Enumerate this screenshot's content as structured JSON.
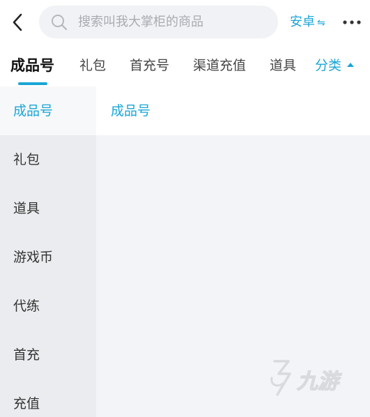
{
  "header": {
    "back_icon": "chevron-left-icon",
    "search": {
      "icon": "search-icon",
      "placeholder": "搜索叫我大掌柜的商品"
    },
    "platform": {
      "label": "安卓",
      "icon": "swap-arrows-icon"
    },
    "more_icon": "more-dots-icon"
  },
  "tabs": {
    "items": [
      {
        "label": "成品号",
        "active": true
      },
      {
        "label": "礼包"
      },
      {
        "label": "首充号"
      },
      {
        "label": "渠道充值"
      },
      {
        "label": "道具"
      }
    ],
    "category_button": {
      "label": "分类",
      "icon": "triangle-up-icon"
    }
  },
  "sidebar": {
    "items": [
      {
        "label": "成品号",
        "active": true
      },
      {
        "label": "礼包"
      },
      {
        "label": "道具"
      },
      {
        "label": "游戏币"
      },
      {
        "label": "代练"
      },
      {
        "label": "首充"
      },
      {
        "label": "充值"
      }
    ]
  },
  "content": {
    "title": "成品号"
  },
  "watermark": {
    "icon": "jiuyou-logo-icon",
    "text": "九游"
  },
  "colors": {
    "accent": "#1ba6d6",
    "sidebar_bg": "#ebecef",
    "content_bg": "#f3f4f8",
    "search_bg": "#f1f2f5"
  }
}
